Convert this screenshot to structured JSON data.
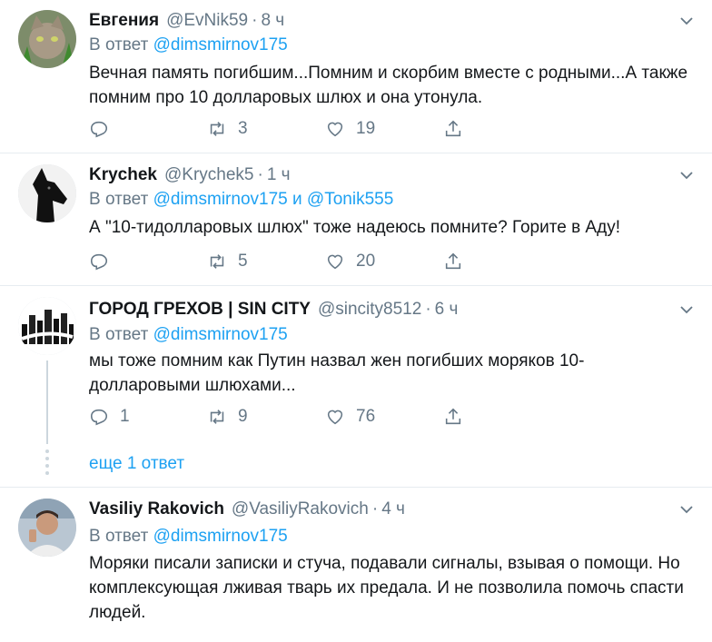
{
  "reply_prefix": "В ответ",
  "conjunction": "и",
  "dot": "·",
  "tweets": [
    {
      "name": "Евгения",
      "handle": "@EvNik59",
      "time": "8 ч",
      "reply_to": [
        "@dimsmirnov175"
      ],
      "text": "Вечная память погибшим...Помним и скорбим вместе с родными...А также помним про 10 долларовых шлюх и она утонула.",
      "replies": "",
      "retweets": "3",
      "likes": "19"
    },
    {
      "name": "Krychek",
      "handle": "@Krychek5",
      "time": "1 ч",
      "reply_to": [
        "@dimsmirnov175",
        "@Tonik555"
      ],
      "text": "А \"10-тидолларовых шлюх\" тоже надеюсь помните? Горите в Аду!",
      "replies": "",
      "retweets": "5",
      "likes": "20"
    },
    {
      "name": "ГОРОД ГРЕХОВ | SIN CITY",
      "handle": "@sincity8512",
      "time": "6 ч",
      "reply_to": [
        "@dimsmirnov175"
      ],
      "text": "мы тоже помним как Путин назвал жен погибших моряков 10-долларовыми шлюхами...",
      "replies": "1",
      "retweets": "9",
      "likes": "76"
    },
    {
      "name": "Vasiliy Rakovich",
      "handle": "@VasiliyRakovich",
      "time": "4 ч",
      "reply_to": [
        "@dimsmirnov175"
      ],
      "text": "Моряки писали записки и стуча, подавали сигналы, взывая о помощи. Но комплексующая лживая тварь их предала. И не позволила помочь спасти людей.",
      "replies": "",
      "retweets": "",
      "likes": ""
    }
  ],
  "show_more": "еще 1 ответ",
  "icons": {
    "reply": "reply-icon",
    "retweet": "retweet-icon",
    "like": "heart-icon",
    "share": "share-icon",
    "caret": "chevron-down-icon"
  },
  "colors": {
    "link": "#1da1f2",
    "muted": "#657786",
    "text": "#14171a",
    "border": "#e6ecf0"
  }
}
